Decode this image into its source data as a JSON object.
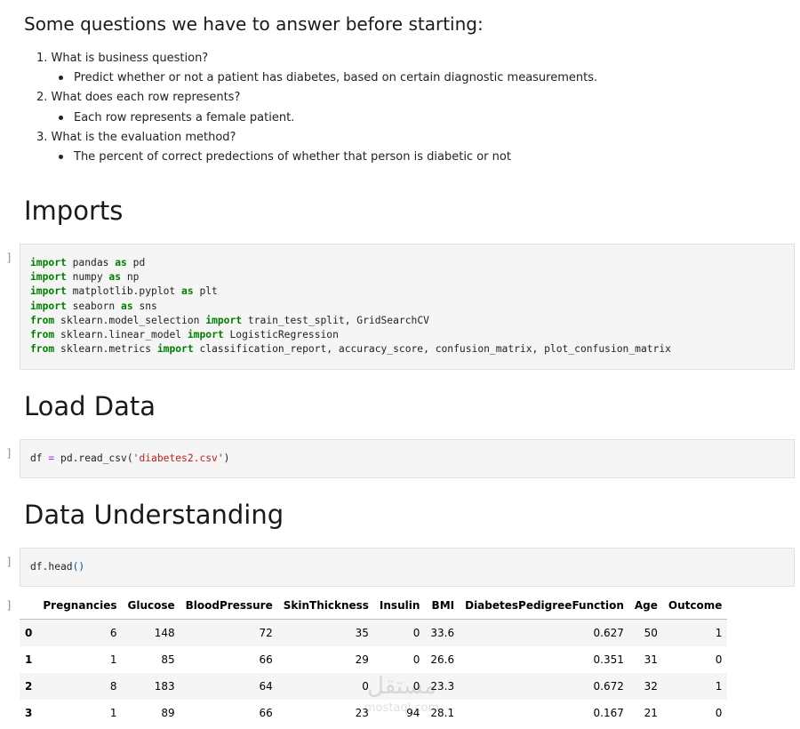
{
  "questions": {
    "heading": "Some questions we have to answer before starting:",
    "items": [
      {
        "num": "1.",
        "text": "What is business question?",
        "sub": "Predict whether or not a patient has diabetes, based on certain diagnostic measurements."
      },
      {
        "num": "2.",
        "text": "What does each row represents?",
        "sub": "Each row represents a female patient."
      },
      {
        "num": "3.",
        "text": "What is the evaluation method?",
        "sub": "The percent of correct predections of whether that person is diabetic or not"
      }
    ]
  },
  "sections": {
    "imports": "Imports",
    "load": "Load Data",
    "understanding": "Data Understanding"
  },
  "prompts": {
    "cell1": "[ ]:",
    "cell2": "[ ]:",
    "cell3": "[ ]:",
    "output3": "[ ]:"
  },
  "code": {
    "imports": [
      [
        [
          "kw",
          "import"
        ],
        [
          "t",
          " pandas "
        ],
        [
          "kw",
          "as"
        ],
        [
          "t",
          " pd"
        ]
      ],
      [
        [
          "kw",
          "import"
        ],
        [
          "t",
          " numpy "
        ],
        [
          "kw",
          "as"
        ],
        [
          "t",
          " np"
        ]
      ],
      [
        [
          "kw",
          "import"
        ],
        [
          "t",
          " matplotlib.pyplot "
        ],
        [
          "kw",
          "as"
        ],
        [
          "t",
          " plt"
        ]
      ],
      [
        [
          "kw",
          "import"
        ],
        [
          "t",
          " seaborn "
        ],
        [
          "kw",
          "as"
        ],
        [
          "t",
          " sns"
        ]
      ],
      [
        [
          "kw",
          "from"
        ],
        [
          "t",
          " sklearn.model_selection "
        ],
        [
          "kw",
          "import"
        ],
        [
          "t",
          " train_test_split, GridSearchCV"
        ]
      ],
      [
        [
          "kw",
          "from"
        ],
        [
          "t",
          " sklearn.linear_model "
        ],
        [
          "kw",
          "import"
        ],
        [
          "t",
          " LogisticRegression"
        ]
      ],
      [
        [
          "kw",
          "from"
        ],
        [
          "t",
          " sklearn.metrics "
        ],
        [
          "kw",
          "import"
        ],
        [
          "t",
          " classification_report, accuracy_score, confusion_matrix, plot_confusion_matrix"
        ]
      ]
    ],
    "load": [
      [
        [
          "t",
          "df "
        ],
        [
          "op",
          "="
        ],
        [
          "t",
          " pd.read_csv("
        ],
        [
          "str",
          "'diabetes2.csv'"
        ],
        [
          "t",
          ")"
        ]
      ]
    ],
    "head": [
      [
        [
          "t",
          "df.head"
        ],
        [
          "paren",
          "()"
        ]
      ]
    ]
  },
  "table": {
    "columns": [
      "Pregnancies",
      "Glucose",
      "BloodPressure",
      "SkinThickness",
      "Insulin",
      "BMI",
      "DiabetesPedigreeFunction",
      "Age",
      "Outcome"
    ],
    "rows": [
      {
        "index": "0",
        "values": [
          "6",
          "148",
          "72",
          "35",
          "0",
          "33.6",
          "0.627",
          "50",
          "1"
        ]
      },
      {
        "index": "1",
        "values": [
          "1",
          "85",
          "66",
          "29",
          "0",
          "26.6",
          "0.351",
          "31",
          "0"
        ]
      },
      {
        "index": "2",
        "values": [
          "8",
          "183",
          "64",
          "0",
          "0",
          "23.3",
          "0.672",
          "32",
          "1"
        ]
      },
      {
        "index": "3",
        "values": [
          "1",
          "89",
          "66",
          "23",
          "94",
          "28.1",
          "0.167",
          "21",
          "0"
        ]
      }
    ]
  },
  "watermark": {
    "brand": "مستقل",
    "site": "mostaql.com"
  }
}
